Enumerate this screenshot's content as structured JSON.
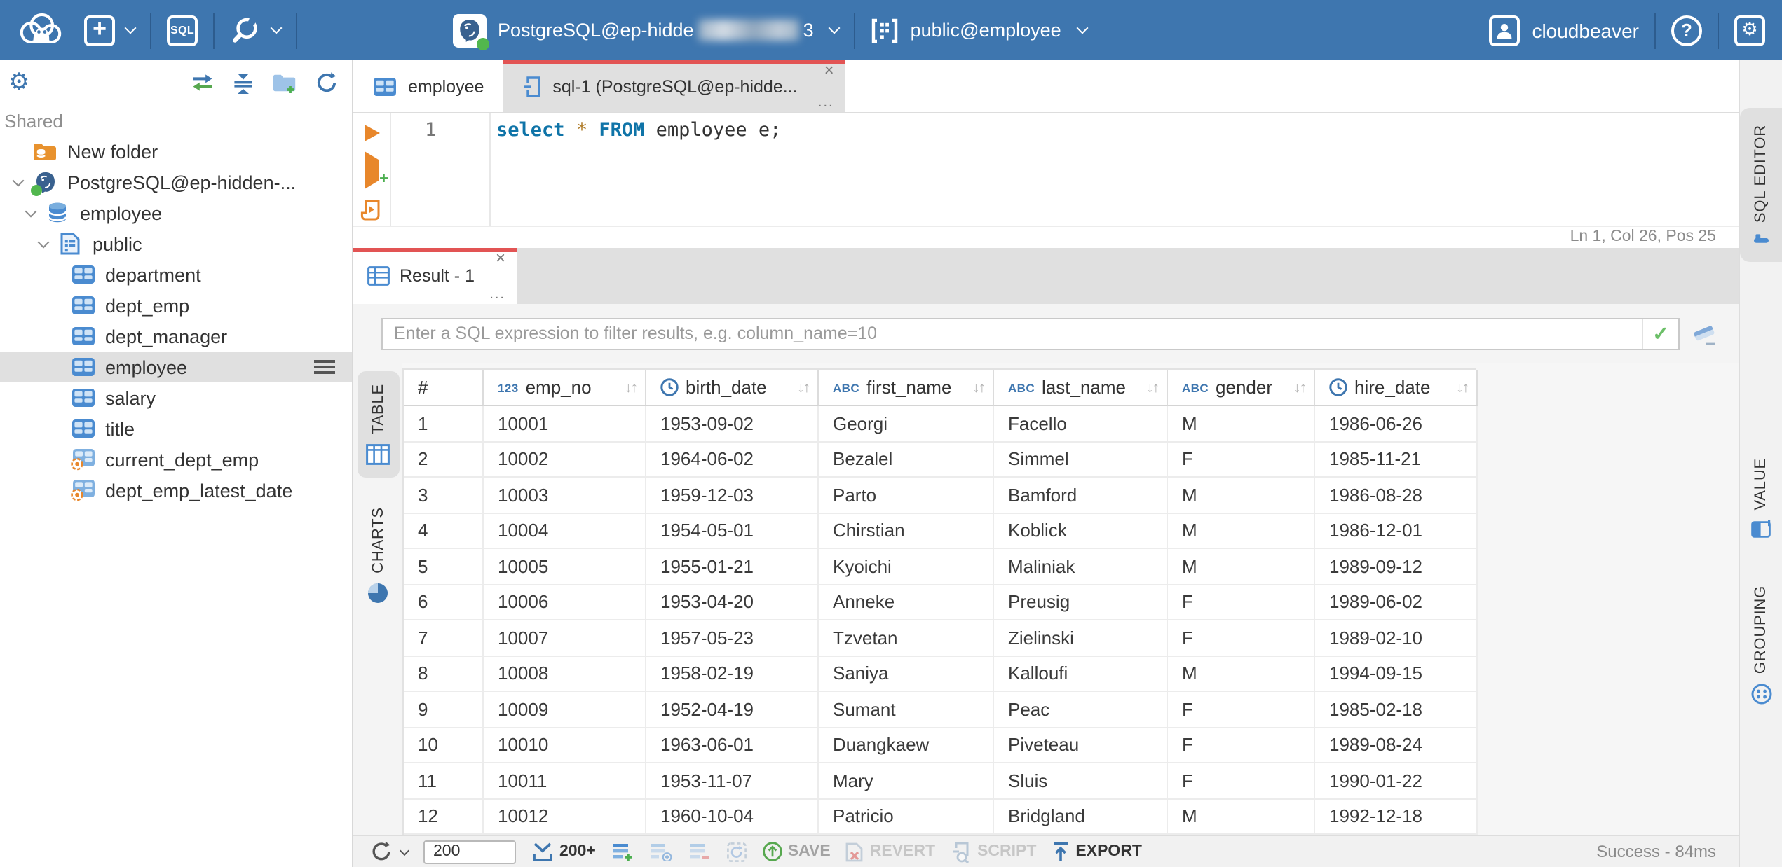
{
  "icons": {
    "plus": "+",
    "question": "?",
    "gear": "⚙",
    "check": "✓",
    "close": "×",
    "ellipsis": "...",
    "sort": "↓↑"
  },
  "colors": {
    "topbar_blue": "#3e76af",
    "accent_red": "#e25454",
    "icon_blue": "#4a8bd0",
    "green": "#52b74e",
    "orange": "#e8872b"
  },
  "topbar": {
    "sql_button_label": "SQL",
    "connection": {
      "name": "PostgreSQL@ep-hidde",
      "suffix": "3"
    },
    "schema": {
      "name": "public@employee"
    },
    "user": {
      "name": "cloudbeaver"
    }
  },
  "sidebar": {
    "section_label": "Shared",
    "tree": [
      {
        "label": "New folder",
        "icon": "folder",
        "level": 0,
        "chevron": false
      },
      {
        "label": "PostgreSQL@ep-hidden-...",
        "icon": "postgres",
        "level": 0,
        "chevron": true
      },
      {
        "label": "employee",
        "icon": "database",
        "level": 1,
        "chevron": true
      },
      {
        "label": "public",
        "icon": "schema",
        "level": 2,
        "chevron": true
      },
      {
        "label": "department",
        "icon": "table",
        "level": 3,
        "chevron": false
      },
      {
        "label": "dept_emp",
        "icon": "table",
        "level": 3,
        "chevron": false
      },
      {
        "label": "dept_manager",
        "icon": "table",
        "level": 3,
        "chevron": false
      },
      {
        "label": "employee",
        "icon": "table",
        "level": 3,
        "chevron": false,
        "selected": true
      },
      {
        "label": "salary",
        "icon": "table",
        "level": 3,
        "chevron": false
      },
      {
        "label": "title",
        "icon": "table",
        "level": 3,
        "chevron": false
      },
      {
        "label": "current_dept_emp",
        "icon": "view",
        "level": 3,
        "chevron": false
      },
      {
        "label": "dept_emp_latest_date",
        "icon": "view",
        "level": 3,
        "chevron": false
      }
    ]
  },
  "editor": {
    "tabs": [
      {
        "label": "employee"
      },
      {
        "label": "sql-1 (PostgreSQL@ep-hidde..."
      }
    ],
    "line_number": "1",
    "code": {
      "kw1": "select",
      "star": " * ",
      "kw2": "FROM",
      "rest": " employee e;"
    },
    "status": "Ln 1, Col 26, Pos 25"
  },
  "result": {
    "tab_label": "Result - 1",
    "filter_placeholder": "Enter a SQL expression to filter results, e.g. column_name=10",
    "left_tabs": [
      {
        "label": "TABLE",
        "active": true
      },
      {
        "label": "CHARTS",
        "active": false
      }
    ],
    "right_tabs": [
      {
        "label": "SQL EDITOR",
        "active": true
      },
      {
        "label": "VALUE",
        "active": false
      },
      {
        "label": "GROUPING",
        "active": false
      }
    ],
    "grid": {
      "index_header": "#",
      "columns": [
        {
          "name": "emp_no",
          "type": "num",
          "badge": "123"
        },
        {
          "name": "birth_date",
          "type": "date"
        },
        {
          "name": "first_name",
          "type": "str",
          "badge": "ABC"
        },
        {
          "name": "last_name",
          "type": "str",
          "badge": "ABC"
        },
        {
          "name": "gender",
          "type": "str",
          "badge": "ABC"
        },
        {
          "name": "hire_date",
          "type": "date"
        }
      ],
      "rows": [
        {
          "n": "1",
          "emp_no": "10001",
          "birth_date": "1953-09-02",
          "first_name": "Georgi",
          "last_name": "Facello",
          "gender": "M",
          "hire_date": "1986-06-26"
        },
        {
          "n": "2",
          "emp_no": "10002",
          "birth_date": "1964-06-02",
          "first_name": "Bezalel",
          "last_name": "Simmel",
          "gender": "F",
          "hire_date": "1985-11-21"
        },
        {
          "n": "3",
          "emp_no": "10003",
          "birth_date": "1959-12-03",
          "first_name": "Parto",
          "last_name": "Bamford",
          "gender": "M",
          "hire_date": "1986-08-28"
        },
        {
          "n": "4",
          "emp_no": "10004",
          "birth_date": "1954-05-01",
          "first_name": "Chirstian",
          "last_name": "Koblick",
          "gender": "M",
          "hire_date": "1986-12-01"
        },
        {
          "n": "5",
          "emp_no": "10005",
          "birth_date": "1955-01-21",
          "first_name": "Kyoichi",
          "last_name": "Maliniak",
          "gender": "M",
          "hire_date": "1989-09-12"
        },
        {
          "n": "6",
          "emp_no": "10006",
          "birth_date": "1953-04-20",
          "first_name": "Anneke",
          "last_name": "Preusig",
          "gender": "F",
          "hire_date": "1989-06-02"
        },
        {
          "n": "7",
          "emp_no": "10007",
          "birth_date": "1957-05-23",
          "first_name": "Tzvetan",
          "last_name": "Zielinski",
          "gender": "F",
          "hire_date": "1989-02-10"
        },
        {
          "n": "8",
          "emp_no": "10008",
          "birth_date": "1958-02-19",
          "first_name": "Saniya",
          "last_name": "Kalloufi",
          "gender": "M",
          "hire_date": "1994-09-15"
        },
        {
          "n": "9",
          "emp_no": "10009",
          "birth_date": "1952-04-19",
          "first_name": "Sumant",
          "last_name": "Peac",
          "gender": "F",
          "hire_date": "1985-02-18"
        },
        {
          "n": "10",
          "emp_no": "10010",
          "birth_date": "1963-06-01",
          "first_name": "Duangkaew",
          "last_name": "Piveteau",
          "gender": "F",
          "hire_date": "1989-08-24"
        },
        {
          "n": "11",
          "emp_no": "10011",
          "birth_date": "1953-11-07",
          "first_name": "Mary",
          "last_name": "Sluis",
          "gender": "F",
          "hire_date": "1990-01-22"
        },
        {
          "n": "12",
          "emp_no": "10012",
          "birth_date": "1960-10-04",
          "first_name": "Patricio",
          "last_name": "Bridgland",
          "gender": "M",
          "hire_date": "1992-12-18"
        }
      ]
    },
    "toolbar": {
      "row_limit": "200",
      "fetch_label": "200+",
      "save_label": "SAVE",
      "revert_label": "REVERT",
      "script_label": "SCRIPT",
      "export_label": "EXPORT",
      "status": "Success - 84ms"
    }
  }
}
